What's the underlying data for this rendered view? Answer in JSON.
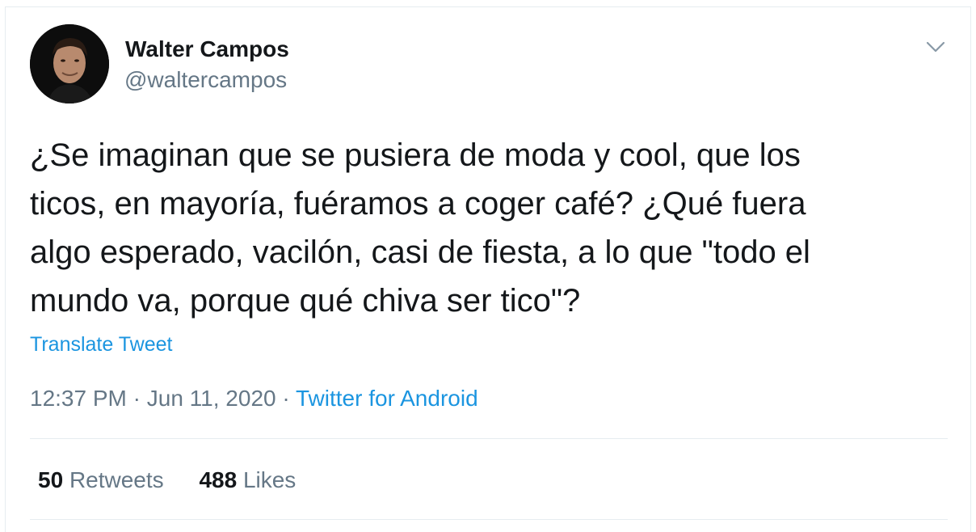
{
  "author": {
    "name": "Walter Campos",
    "handle": "@waltercampos"
  },
  "icons": {
    "avatar": "profile-photo",
    "caret": "chevron-down-icon"
  },
  "tweet": {
    "text": "¿Se imaginan que se pusiera de moda y cool, que los\nticos, en mayoría, fuéramos a coger café? ¿Qué fuera\nalgo esperado, vacilón, casi de fiesta, a lo que \"todo el\nmundo va, porque qué chiva ser tico\"?",
    "translate_label": "Translate Tweet"
  },
  "meta": {
    "time": "12:37 PM",
    "separator": "·",
    "date": "Jun 11, 2020",
    "source": "Twitter for Android"
  },
  "stats": {
    "retweets_count": "50",
    "retweets_label": "Retweets",
    "likes_count": "488",
    "likes_label": "Likes"
  },
  "colors": {
    "text_primary": "#14171a",
    "text_secondary": "#657786",
    "link": "#1b95e0",
    "divider": "#e6ecf0"
  }
}
